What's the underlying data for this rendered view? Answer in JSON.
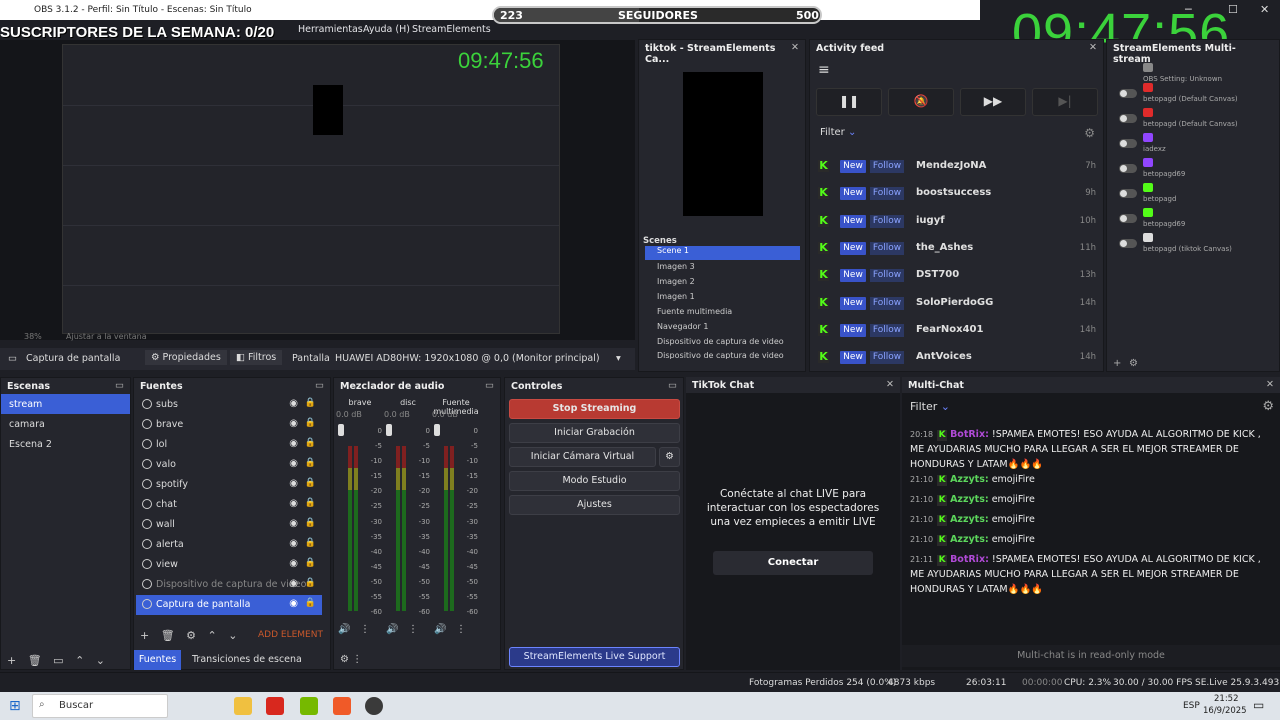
{
  "window": {
    "title": "OBS 3.1.2 - Perfil: Sin Título - Escenas: Sin Título",
    "controls": [
      "─",
      "☐",
      "✕"
    ]
  },
  "overlay": {
    "subs_text": "SUSCRIPTORES DE LA SEMANA: 0/20",
    "followers_current": "223",
    "followers_label": "SEGUIDORES",
    "followers_goal": "500",
    "followers_progress": 0.446,
    "clock": "09:47:56"
  },
  "menu": [
    "Herramientas",
    "Ayuda (H)",
    "StreamElements"
  ],
  "preview": {
    "zoom": "38%",
    "fit_label": "Ajustar a la ventana"
  },
  "source_bar": {
    "source_name": "Captura de pantalla",
    "props": "Propiedades",
    "filters": "Filtros",
    "screen_label": "Pantalla",
    "screen_value": "HUAWEI AD80HW: 1920x1080 @ 0,0 (Monitor principal)"
  },
  "tiktok_panel": {
    "title": "tiktok - StreamElements Ca...",
    "scenes_header": "Scenes",
    "scene_selected": "Scene 1",
    "sources": [
      "Imagen 3",
      "Imagen 2",
      "Imagen 1",
      "Fuente multimedia",
      "Navegador 1",
      "Dispositivo de captura de video",
      "Dispositivo de captura de video"
    ]
  },
  "activity": {
    "title": "Activity feed",
    "filter": "Filter",
    "new_label": "New",
    "follow_label": "Follow",
    "items": [
      {
        "name": "MendezJoNA",
        "time": "7h"
      },
      {
        "name": "boostsuccess",
        "time": "9h"
      },
      {
        "name": "iugyf",
        "time": "10h"
      },
      {
        "name": "the_Ashes",
        "time": "11h"
      },
      {
        "name": "DST700",
        "time": "13h"
      },
      {
        "name": "SoloPierdoGG",
        "time": "14h"
      },
      {
        "name": "FearNox401",
        "time": "14h"
      },
      {
        "name": "AntVoices",
        "time": "14h"
      }
    ]
  },
  "multichat_settings": {
    "title": "StreamElements Multi-stream",
    "items": [
      {
        "label": "OBS Setting: Unknown",
        "color": "#888888"
      },
      {
        "label": "betopagd (Default Canvas)",
        "color": "#e02b2b"
      },
      {
        "label": "betopagd (Default Canvas)",
        "color": "#e02b2b"
      },
      {
        "label": "iadexz",
        "color": "#9146ff"
      },
      {
        "label": "betopagd69",
        "color": "#9146ff"
      },
      {
        "label": "betopagd",
        "color": "#53fc18"
      },
      {
        "label": "betopagd69",
        "color": "#53fc18"
      },
      {
        "label": "betopagd (tiktok Canvas)",
        "color": "#dddddd"
      }
    ]
  },
  "scenes": {
    "title": "Escenas",
    "items": [
      "stream",
      "camara",
      "Escena 2"
    ],
    "selected": 0
  },
  "sources": {
    "title": "Fuentes",
    "items": [
      "subs",
      "brave",
      "lol",
      "valo",
      "spotify",
      "chat",
      "wall",
      "alerta",
      "view",
      "Dispositivo de captura de video",
      "Captura de pantalla"
    ],
    "selected": 10,
    "add_label": "ADD ELEMENT",
    "tab_sources": "Fuentes",
    "tab_transitions": "Transiciones de escena"
  },
  "mixer": {
    "title": "Mezclador de audio",
    "channels": [
      {
        "name": "brave",
        "db": "0.0 dB"
      },
      {
        "name": "disc",
        "db": "0.0 dB"
      },
      {
        "name": "Fuente multimedia",
        "db": "0.0 dB"
      }
    ],
    "scale": [
      "0",
      "-5",
      "-10",
      "-15",
      "-20",
      "-25",
      "-30",
      "-35",
      "-40",
      "-45",
      "-50",
      "-55",
      "-60"
    ]
  },
  "controls": {
    "title": "Controles",
    "stop": "Stop Streaming",
    "record": "Iniciar Grabación",
    "vcam": "Iniciar Cámara Virtual",
    "studio": "Modo Estudio",
    "settings": "Ajustes",
    "se_support": "StreamElements Live Support"
  },
  "tiktok_chat": {
    "title": "TikTok Chat",
    "message": "Conéctate al chat LIVE para interactuar con los espectadores una vez empieces a emitir LIVE",
    "connect": "Conectar"
  },
  "multichat": {
    "title": "Multi-Chat",
    "filter": "Filter",
    "readonly": "Multi-chat is in read-only mode",
    "messages": [
      {
        "time": "20:18",
        "user": "BotRix:",
        "bot": true,
        "text": "!SPAMEA EMOTES! ESO AYUDA AL ALGORITMO DE KICK , ME AYUDARIAS MUCHO PARA LLEGAR A SER EL MEJOR STREAMER DE HONDURAS Y LATAM🔥🔥🔥"
      },
      {
        "time": "21:10",
        "user": "Azzyts:",
        "bot": false,
        "text": "emojiFire"
      },
      {
        "time": "21:10",
        "user": "Azzyts:",
        "bot": false,
        "text": "emojiFire"
      },
      {
        "time": "21:10",
        "user": "Azzyts:",
        "bot": false,
        "text": "emojiFire"
      },
      {
        "time": "21:10",
        "user": "Azzyts:",
        "bot": false,
        "text": "emojiFire"
      },
      {
        "time": "21:11",
        "user": "BotRix:",
        "bot": true,
        "text": "!SPAMEA EMOTES! ESO AYUDA AL ALGORITMO DE KICK , ME AYUDARIAS MUCHO PARA LLEGAR A SER EL MEJOR STREAMER DE HONDURAS Y LATAM🔥🔥🔥"
      }
    ]
  },
  "status": {
    "frames": "Fotogramas Perdidos 254 (0.0%)",
    "kbps": "4873 kbps",
    "live_time": "26:03:11",
    "rec_time": "00:00:00",
    "cpu": "CPU: 2.3%",
    "fps": "30.00 / 30.00 FPS",
    "version": "SE.Live 25.9.3.493"
  },
  "taskbar": {
    "search": "Buscar",
    "lang": "ESP",
    "time": "21:52",
    "date": "16/9/2025"
  }
}
